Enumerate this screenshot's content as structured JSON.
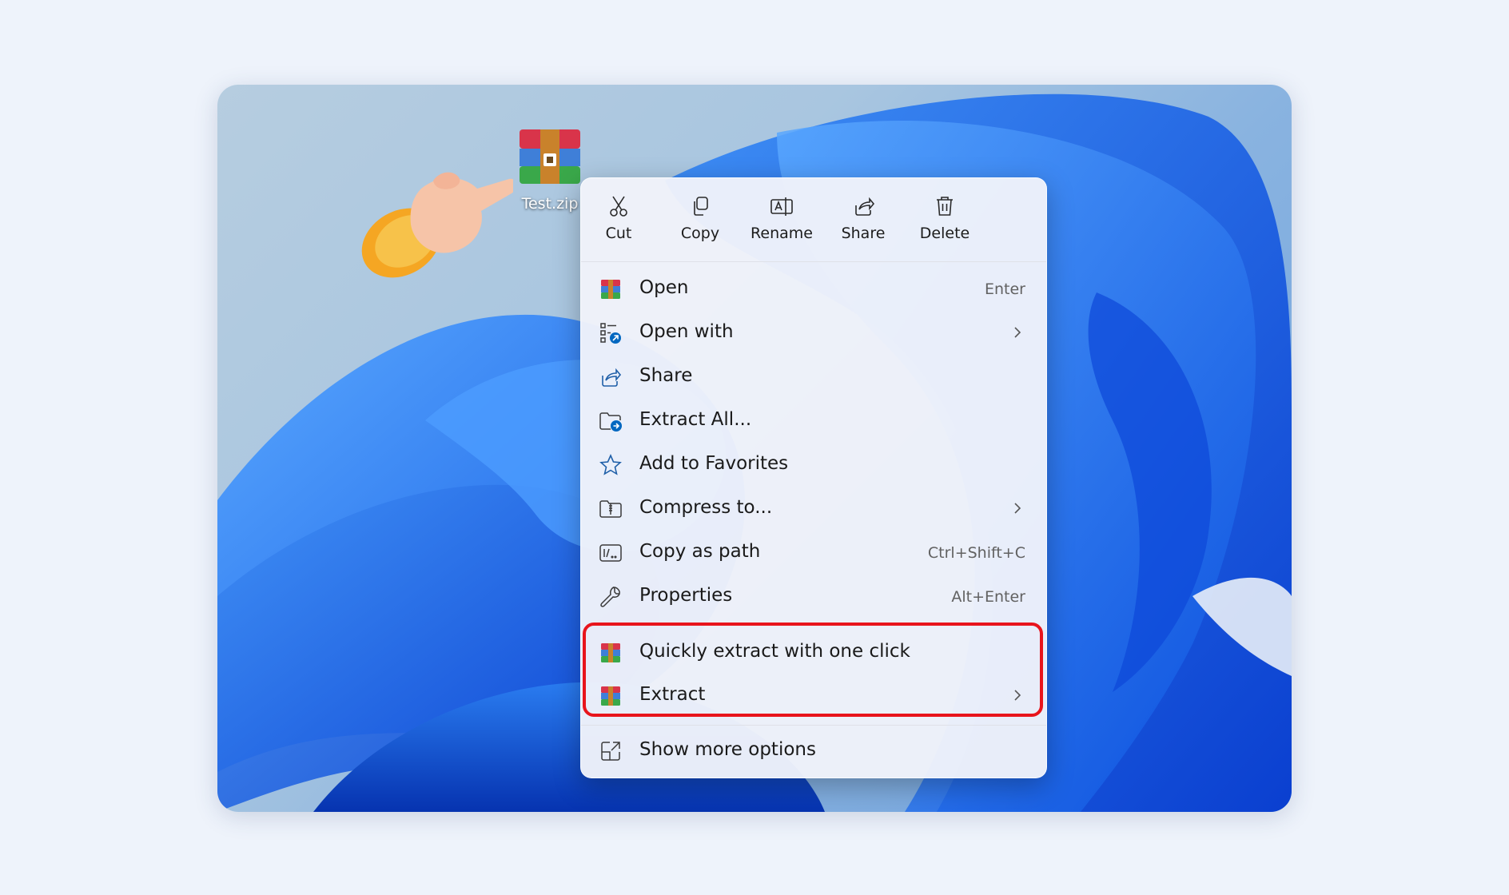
{
  "desktop": {
    "file_label": "Test.zip"
  },
  "quick_actions": [
    {
      "label": "Cut",
      "icon": "scissors-icon"
    },
    {
      "label": "Copy",
      "icon": "copy-icon"
    },
    {
      "label": "Rename",
      "icon": "rename-icon"
    },
    {
      "label": "Share",
      "icon": "share-icon"
    },
    {
      "label": "Delete",
      "icon": "trash-icon"
    }
  ],
  "menu_items": [
    {
      "label": "Open",
      "shortcut": "Enter",
      "icon": "archive-icon"
    },
    {
      "label": "Open with",
      "shortcut": "",
      "icon": "open-with-icon",
      "submenu": true
    },
    {
      "label": "Share",
      "shortcut": "",
      "icon": "share-icon"
    },
    {
      "label": "Extract All...",
      "shortcut": "",
      "icon": "extract-folder-icon"
    },
    {
      "label": "Add to Favorites",
      "shortcut": "",
      "icon": "star-icon"
    },
    {
      "label": "Compress to...",
      "shortcut": "",
      "icon": "compress-icon",
      "submenu": true
    },
    {
      "label": "Copy as path",
      "shortcut": "Ctrl+Shift+C",
      "icon": "path-icon"
    },
    {
      "label": "Properties",
      "shortcut": "Alt+Enter",
      "icon": "wrench-icon"
    },
    {
      "label": "Quickly extract with one click",
      "shortcut": "",
      "icon": "archive-icon"
    },
    {
      "label": "Extract",
      "shortcut": "",
      "icon": "archive-icon",
      "submenu": true
    },
    {
      "label": "Show more options",
      "shortcut": "",
      "icon": "more-options-icon"
    }
  ],
  "colors": {
    "highlight": "#e8141c",
    "accent": "#0067c0"
  }
}
